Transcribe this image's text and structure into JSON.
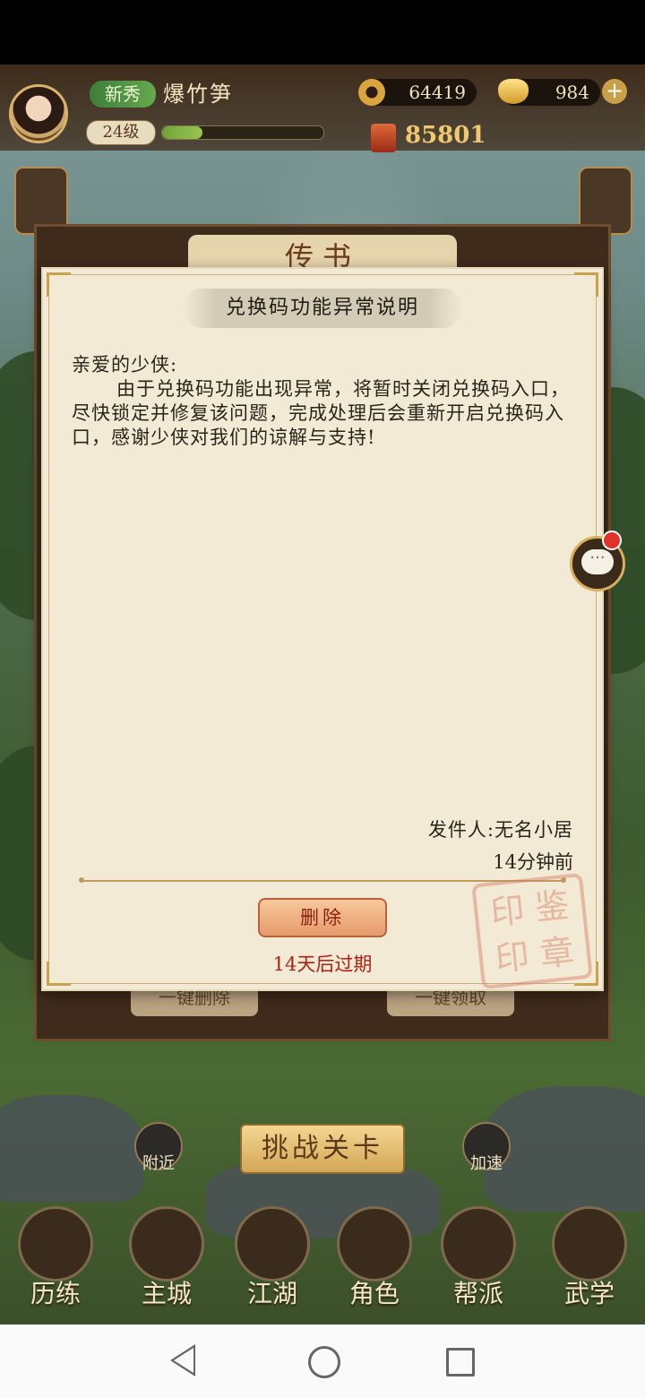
{
  "hud": {
    "rank": "新秀",
    "player_name": "爆竹笋",
    "level": "24级",
    "exp_fraction": 0.25,
    "copper": "64419",
    "gold": "984",
    "power": "85801"
  },
  "popup": {
    "title": "传书",
    "delete_all_label": "一键删除",
    "claim_all_label": "一键领取"
  },
  "mail": {
    "subject": "兑换码功能异常说明",
    "greeting": "亲爱的少侠:",
    "body": "由于兑换码功能出现异常，将暂时关闭兑换码入口，尽快锁定并修复该问题，完成处理后会重新开启兑换码入口，感谢少侠对我们的谅解与支持!",
    "sender": "发件人:无名小居",
    "time": "14分钟前",
    "delete_label": "删除",
    "expire": "14天后过期"
  },
  "bottom": {
    "nearby": "附近",
    "speedup": "加速",
    "challenge": "挑战关卡",
    "nav": [
      "历练",
      "主城",
      "江湖",
      "角色",
      "帮派",
      "武学"
    ]
  },
  "colors": {
    "accent_red": "#b11f14",
    "paper": "#f2ead4",
    "frame": "#c9a24e"
  }
}
